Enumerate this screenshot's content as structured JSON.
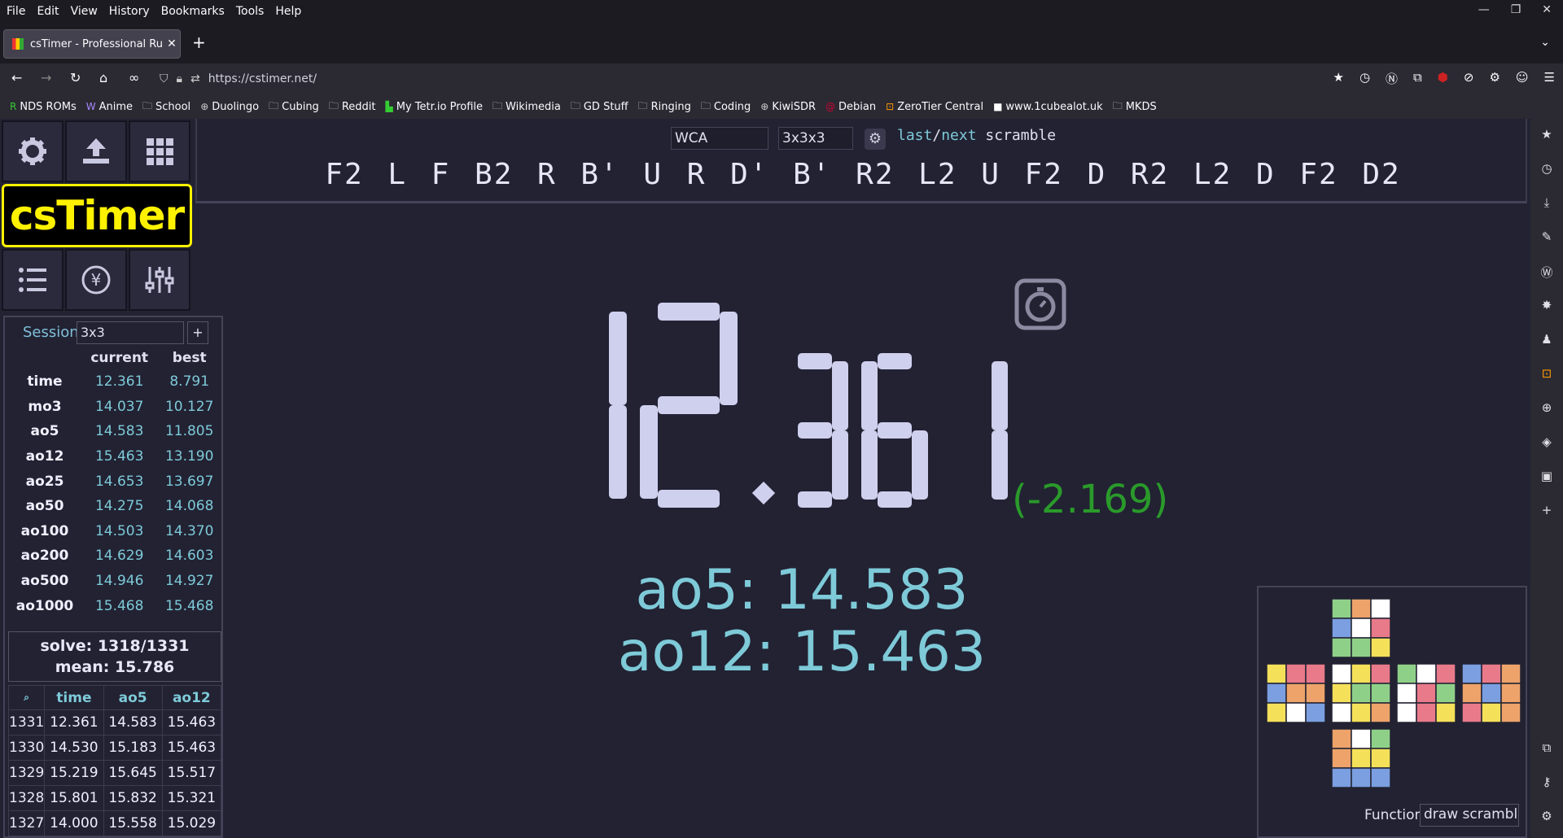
{
  "browser": {
    "menu": [
      "File",
      "Edit",
      "View",
      "History",
      "Bookmarks",
      "Tools",
      "Help"
    ],
    "tab_title": "csTimer - Professional Rubik",
    "url": "https://cstimer.net/",
    "bookmarks": [
      {
        "label": "NDS ROMs",
        "icon": "R"
      },
      {
        "label": "Anime",
        "icon": "W"
      },
      {
        "label": "School",
        "icon": "folder"
      },
      {
        "label": "Duolingo",
        "icon": "globe"
      },
      {
        "label": "Cubing",
        "icon": "folder"
      },
      {
        "label": "Reddit",
        "icon": "folder"
      },
      {
        "label": "My Tetr.io Profile",
        "icon": "tetr"
      },
      {
        "label": "Wikimedia",
        "icon": "folder"
      },
      {
        "label": "GD Stuff",
        "icon": "folder"
      },
      {
        "label": "Ringing",
        "icon": "folder"
      },
      {
        "label": "Coding",
        "icon": "folder"
      },
      {
        "label": "KiwiSDR",
        "icon": "globe"
      },
      {
        "label": "Debian",
        "icon": "debian"
      },
      {
        "label": "ZeroTier Central",
        "icon": "zt"
      },
      {
        "label": "www.1cubealot.uk",
        "icon": "square"
      },
      {
        "label": "MKDS",
        "icon": "folder"
      }
    ]
  },
  "app": {
    "logo": "csTimer",
    "scramble_type": "WCA",
    "scramble_sub": "3x3x3",
    "last_next": {
      "a": "last",
      "sep": "/",
      "b": "next",
      "c": " scramble"
    },
    "scramble": "F2 L F B2 R B' U R D' B' R2 L2 U F2 D R2 L2 D F2 D2",
    "timer": "12.361",
    "delta": "(-2.169)",
    "ao5_line": "ao5: 14.583",
    "ao12_line": "ao12: 15.463",
    "session_label": "Session",
    "session_value": "3x3",
    "session_add": "+",
    "stats_headers": [
      "",
      "current",
      "best"
    ],
    "stats": [
      {
        "label": "time",
        "current": "12.361",
        "best": "8.791"
      },
      {
        "label": "mo3",
        "current": "14.037",
        "best": "10.127"
      },
      {
        "label": "ao5",
        "current": "14.583",
        "best": "11.805"
      },
      {
        "label": "ao12",
        "current": "15.463",
        "best": "13.190"
      },
      {
        "label": "ao25",
        "current": "14.653",
        "best": "13.697"
      },
      {
        "label": "ao50",
        "current": "14.275",
        "best": "14.068"
      },
      {
        "label": "ao100",
        "current": "14.503",
        "best": "14.370"
      },
      {
        "label": "ao200",
        "current": "14.629",
        "best": "14.603"
      },
      {
        "label": "ao500",
        "current": "14.946",
        "best": "14.927"
      },
      {
        "label": "ao1000",
        "current": "15.468",
        "best": "15.468"
      }
    ],
    "summary_solve": "solve: 1318/1331",
    "summary_mean": "mean: 15.786",
    "times_headers": [
      "⌕",
      "time",
      "ao5",
      "ao12"
    ],
    "times": [
      [
        "1331",
        "12.361",
        "14.583",
        "15.463"
      ],
      [
        "1330",
        "14.530",
        "15.183",
        "15.463"
      ],
      [
        "1329",
        "15.219",
        "15.645",
        "15.517"
      ],
      [
        "1328",
        "15.801",
        "15.832",
        "15.321"
      ],
      [
        "1327",
        "14.000",
        "15.558",
        "15.029"
      ]
    ],
    "function_label": "Function",
    "function_value": "draw scramble",
    "colors": {
      "timer_digits": "#cfcfee",
      "accent": "#7ecad8",
      "delta_green": "#2a9a2a",
      "logo_yellow": "#fff200"
    }
  }
}
